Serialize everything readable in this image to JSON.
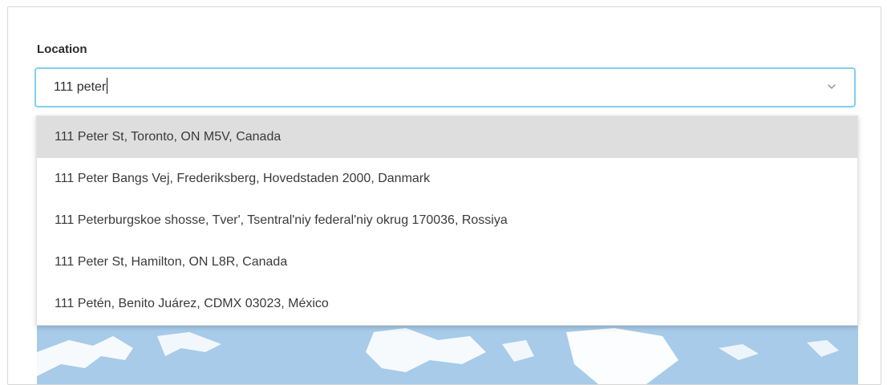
{
  "location_field": {
    "label": "Location",
    "input_value": "111 peter"
  },
  "suggestions": [
    "111 Peter St, Toronto, ON M5V, Canada",
    "111 Peter Bangs Vej, Frederiksberg, Hovedstaden 2000, Danmark",
    "111 Peterburgskoe shosse, Tver', Tsentral'niy federal'niy okrug 170036, Rossiya",
    "111 Peter St, Hamilton, ON L8R, Canada",
    "111 Petén, Benito Juárez, CDMX 03023, México"
  ],
  "highlighted_index": 0,
  "colors": {
    "focus_border": "#7fd0ee",
    "highlight_bg": "#dedede",
    "map_water": "#a7cbe9",
    "map_land": "#ffffff"
  },
  "icons": {
    "dropdown": "chevron-down-icon"
  }
}
